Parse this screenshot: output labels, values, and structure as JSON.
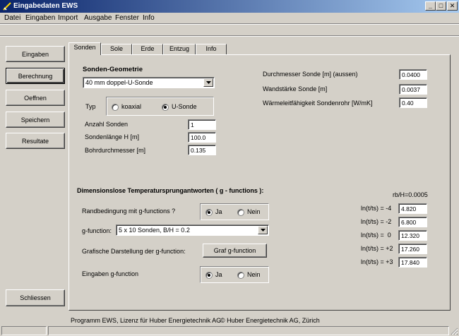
{
  "window": {
    "title": "Eingabedaten EWS",
    "min": "_",
    "max": "□",
    "close": "✕"
  },
  "menu": [
    "Datei",
    "Eingaben",
    "Import",
    "Ausgabe",
    "Fenster",
    "Info"
  ],
  "sidebar": {
    "eingaben": "Eingaben",
    "berechnung": "Berechnung",
    "oeffnen": "Oeffnen",
    "speichern": "Speichern",
    "resultate": "Resultate",
    "schliessen": "Schliessen"
  },
  "tabs": [
    "Sonden",
    "Sole",
    "Erde",
    "Entzug",
    "Info"
  ],
  "geometry": {
    "heading": "Sonden-Geometrie",
    "type_select": "40 mm doppel-U-Sonde",
    "typ_label": "Typ",
    "koaxial": "koaxial",
    "usonde": "U-Sonde",
    "anzahl_label": "Anzahl Sonden",
    "anzahl_value": "1",
    "laenge_label": "Sondenlänge H [m]",
    "laenge_value": "100.0",
    "bohr_label": "Bohrdurchmesser [m]",
    "bohr_value": "0.135"
  },
  "right": {
    "durchmesser_label": "Durchmesser Sonde [m] (aussen)",
    "durchmesser_value": "0.0400",
    "wand_label": "Wandstärke Sonde [m]",
    "wand_value": "0.0037",
    "waerme_label": "Wärmeleitfähigkeit Sondenrohr [W/mK]",
    "waerme_value": "0.40"
  },
  "gfunc": {
    "heading": "Dimensionslose Temperatursprungantworten  ( g - functions ):",
    "rb_label": "rb/H=0.0005",
    "rand_label": "Randbedingung mit g-functions ?",
    "ja": "Ja",
    "nein": "Nein",
    "gf_label": "g-function:",
    "gf_select": "5 x 10 Sonden,  B/H = 0.2",
    "graf_label": "Grafische Darstellung der g-function:",
    "graf_button": "Graf g-function",
    "eingaben_label": "Eingaben  g-function",
    "ln_rows": [
      {
        "label": "ln(t/ts) = -4",
        "value": "4.820"
      },
      {
        "label": "ln(t/ts) = -2",
        "value": "6.800"
      },
      {
        "label": "ln(t/ts) =  0",
        "value": "12.320"
      },
      {
        "label": "ln(t/ts) = +2",
        "value": "17.260"
      },
      {
        "label": "ln(t/ts) = +3",
        "value": "17.840"
      }
    ]
  },
  "footer": {
    "license": "Programm EWS, Lizenz für Huber Energietechnik AG",
    "copyright": "© Huber Energietechnik AG, Zürich"
  }
}
